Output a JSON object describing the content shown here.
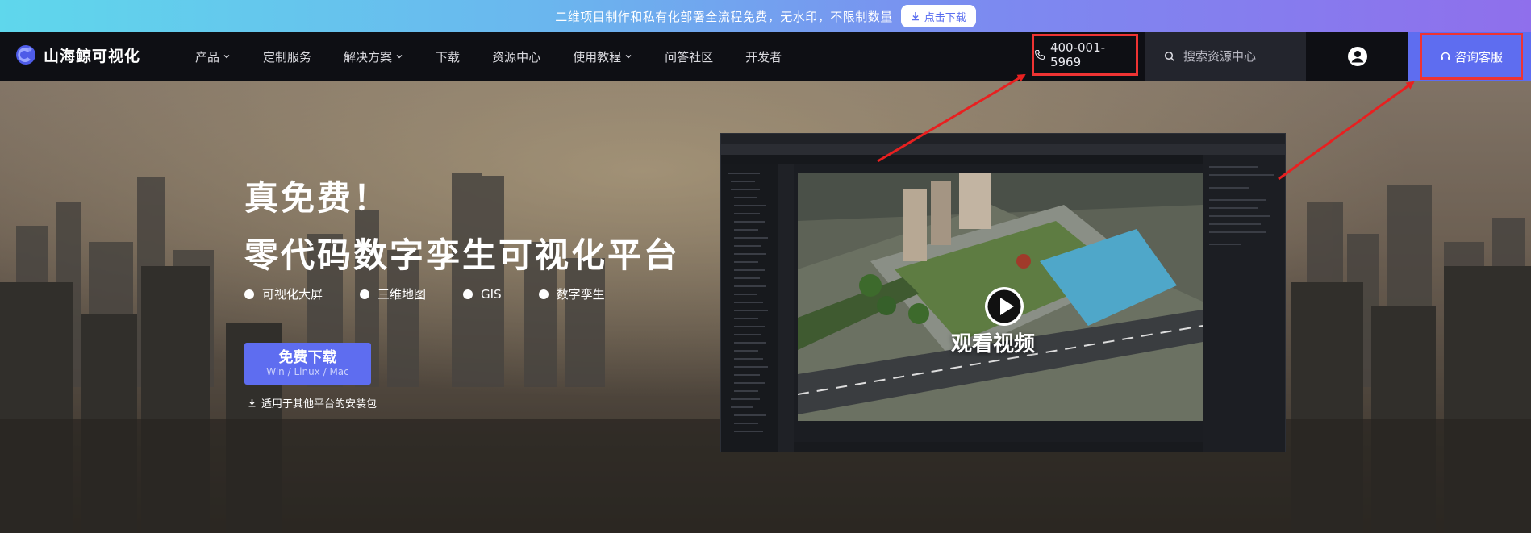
{
  "banner": {
    "text": "二维项目制作和私有化部署全流程免费，无水印，不限制数量",
    "button_label": "点击下载"
  },
  "nav": {
    "logo_text": "山海鲸可视化",
    "menu": [
      {
        "label": "产品",
        "has_dropdown": true
      },
      {
        "label": "定制服务",
        "has_dropdown": false
      },
      {
        "label": "解决方案",
        "has_dropdown": true
      },
      {
        "label": "下载",
        "has_dropdown": false
      },
      {
        "label": "资源中心",
        "has_dropdown": false
      },
      {
        "label": "使用教程",
        "has_dropdown": true
      },
      {
        "label": "问答社区",
        "has_dropdown": false
      },
      {
        "label": "开发者",
        "has_dropdown": false
      }
    ],
    "phone": "400-001-5969",
    "search_placeholder": "搜索资源中心",
    "contact_label": "咨询客服"
  },
  "hero": {
    "title_line1": "真免费！",
    "title_line2": "零代码数字孪生可视化平台",
    "features": [
      "可视化大屏",
      "三维地图",
      "GIS",
      "数字孪生"
    ],
    "download_button": {
      "title": "免费下载",
      "subtitle": "Win / Linux / Mac"
    },
    "other_platforms_link": "适用于其他平台的安装包",
    "video_label": "观看视频"
  },
  "colors": {
    "accent": "#5e6df0",
    "nav_bg": "#0e0f14",
    "highlight_border": "#ee3333",
    "annotation_arrow": "#e82020"
  },
  "icons": {
    "banner_button": "download-icon",
    "phone": "phone-icon",
    "search": "search-icon",
    "account": "user-avatar-icon",
    "contact": "headset-icon",
    "play": "play-icon"
  }
}
